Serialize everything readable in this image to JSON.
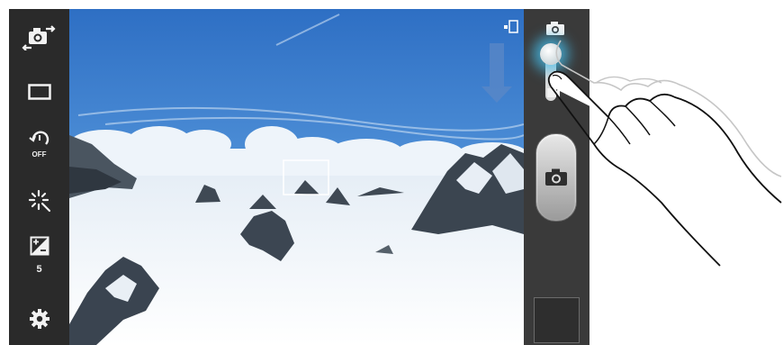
{
  "left_toolbar": {
    "items": [
      {
        "name": "switch-camera",
        "icon": "camera-switch-icon"
      },
      {
        "name": "aspect-ratio",
        "icon": "rectangle-icon"
      },
      {
        "name": "timer",
        "icon": "timer-off-icon",
        "label": "OFF"
      },
      {
        "name": "effects",
        "icon": "sparkle-icon"
      },
      {
        "name": "exposure",
        "icon": "exposure-icon",
        "value": "5"
      },
      {
        "name": "settings",
        "icon": "gear-icon"
      }
    ]
  },
  "right_panel": {
    "mode_icons": [
      "camera-icon",
      "video-icon"
    ],
    "accent_color": "#46bee8"
  }
}
